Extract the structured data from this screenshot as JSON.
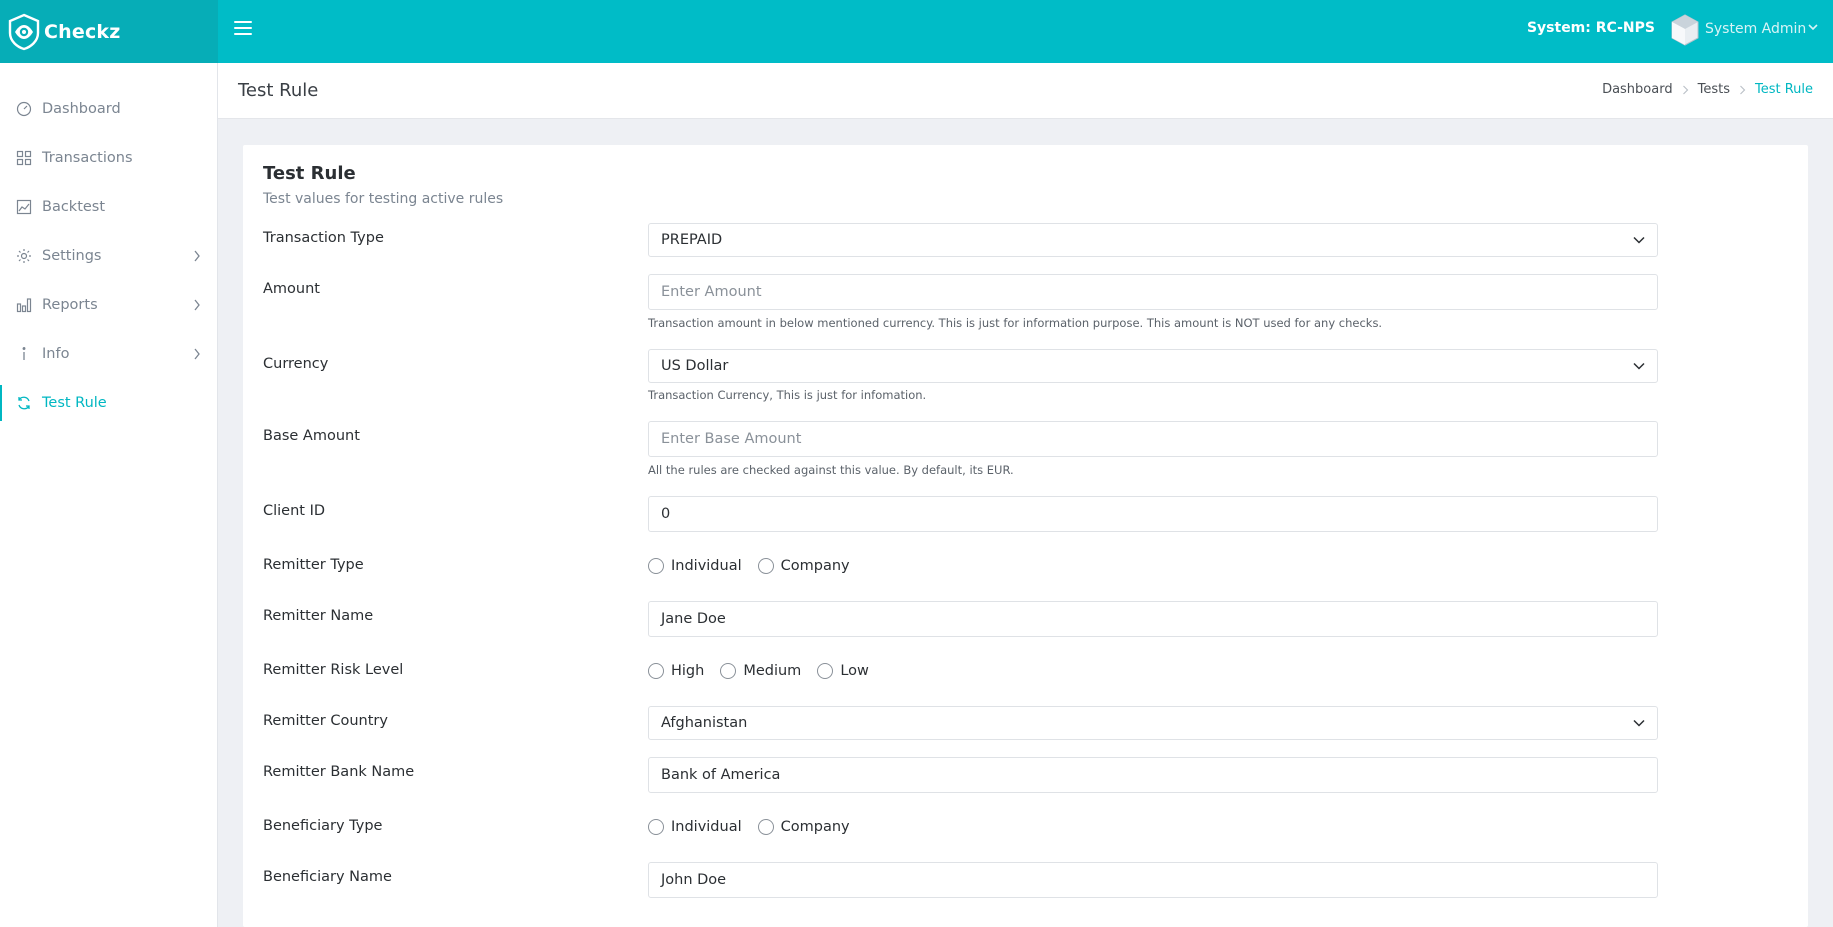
{
  "app": {
    "brand": "Checkz",
    "system_label": "System: RC-NPS",
    "user_name": "System Admin"
  },
  "sidebar": {
    "items": [
      {
        "label": "Dashboard",
        "icon": "dashboard-gauge-icon"
      },
      {
        "label": "Transactions",
        "icon": "grid-icon"
      },
      {
        "label": "Backtest",
        "icon": "image-chart-icon"
      },
      {
        "label": "Settings",
        "icon": "gear-icon"
      },
      {
        "label": "Reports",
        "icon": "bar-chart-icon"
      },
      {
        "label": "Info",
        "icon": "info-icon"
      },
      {
        "label": "Test Rule",
        "icon": "refresh-icon"
      }
    ],
    "active_index": 6
  },
  "header": {
    "title": "Test Rule",
    "breadcrumb": [
      "Dashboard",
      "Tests",
      "Test Rule"
    ]
  },
  "form": {
    "title": "Test Rule",
    "subtitle": "Test values for testing active rules",
    "transaction_type": {
      "label": "Transaction Type",
      "value": "PREPAID"
    },
    "amount": {
      "label": "Amount",
      "placeholder": "Enter Amount",
      "help": "Transaction amount in below mentioned currency. This is just for information purpose. This amount is NOT used for any checks."
    },
    "currency": {
      "label": "Currency",
      "value": "US Dollar",
      "help": "Transaction Currency, This is just for infomation."
    },
    "base_amount": {
      "label": "Base Amount",
      "placeholder": "Enter Base Amount",
      "help": "All the rules are checked against this value. By default, its EUR."
    },
    "client_id": {
      "label": "Client ID",
      "value": "0"
    },
    "remitter_type": {
      "label": "Remitter Type",
      "options": [
        "Individual",
        "Company"
      ]
    },
    "remitter_name": {
      "label": "Remitter Name",
      "value": "Jane Doe"
    },
    "remitter_risk": {
      "label": "Remitter Risk Level",
      "options": [
        "High",
        "Medium",
        "Low"
      ]
    },
    "remitter_country": {
      "label": "Remitter Country",
      "value": "Afghanistan"
    },
    "remitter_bank": {
      "label": "Remitter Bank Name",
      "value": "Bank of America"
    },
    "beneficiary_type": {
      "label": "Beneficiary Type",
      "options": [
        "Individual",
        "Company"
      ]
    },
    "beneficiary_name": {
      "label": "Beneficiary Name",
      "value": "John Doe"
    }
  },
  "colors": {
    "accent": "#00bcc7",
    "brand_bg": "#06adb7",
    "page_bg": "#eef0f4"
  }
}
